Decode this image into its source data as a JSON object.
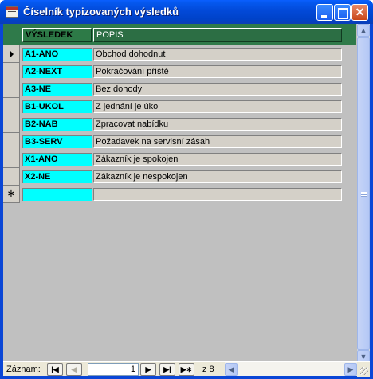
{
  "window": {
    "title": "Číselník typizovaných výsledků",
    "minimize_label": "",
    "maximize_label": "",
    "close_label": "✕"
  },
  "header": {
    "col1": "VÝSLEDEK",
    "col2": "POPIS"
  },
  "rows": [
    {
      "selector": "",
      "code": "A1-ANO",
      "desc": "Obchod dohodnut"
    },
    {
      "selector": "",
      "code": "A2-NEXT",
      "desc": "Pokračování příště"
    },
    {
      "selector": "",
      "code": "A3-NE",
      "desc": "Bez dohody"
    },
    {
      "selector": "",
      "code": "B1-UKOL",
      "desc": "Z jednání je úkol"
    },
    {
      "selector": "",
      "code": "B2-NAB",
      "desc": "Zpracovat nabídku"
    },
    {
      "selector": "",
      "code": "B3-SERV",
      "desc": "Požadavek na servisní zásah"
    },
    {
      "selector": "",
      "code": "X1-ANO",
      "desc": "Zákazník je spokojen"
    },
    {
      "selector": "",
      "code": "X2-NE",
      "desc": "Zákazník je nespokojen"
    },
    {
      "selector": "∗",
      "code": "",
      "desc": ""
    }
  ],
  "navigation": {
    "label": "Záznam:",
    "first": "|◀",
    "prev": "◀",
    "record_value": "1",
    "next": "▶",
    "last": "▶|",
    "new": "▶∗",
    "of_text": "z 8"
  },
  "scrollbar": {
    "up": "▲",
    "down": "▼",
    "left": "◀",
    "right": "▶"
  },
  "colors": {
    "header_bg": "#2f7a4a",
    "code_bg": "#00ffff",
    "title_bar": "#0a46d6"
  }
}
